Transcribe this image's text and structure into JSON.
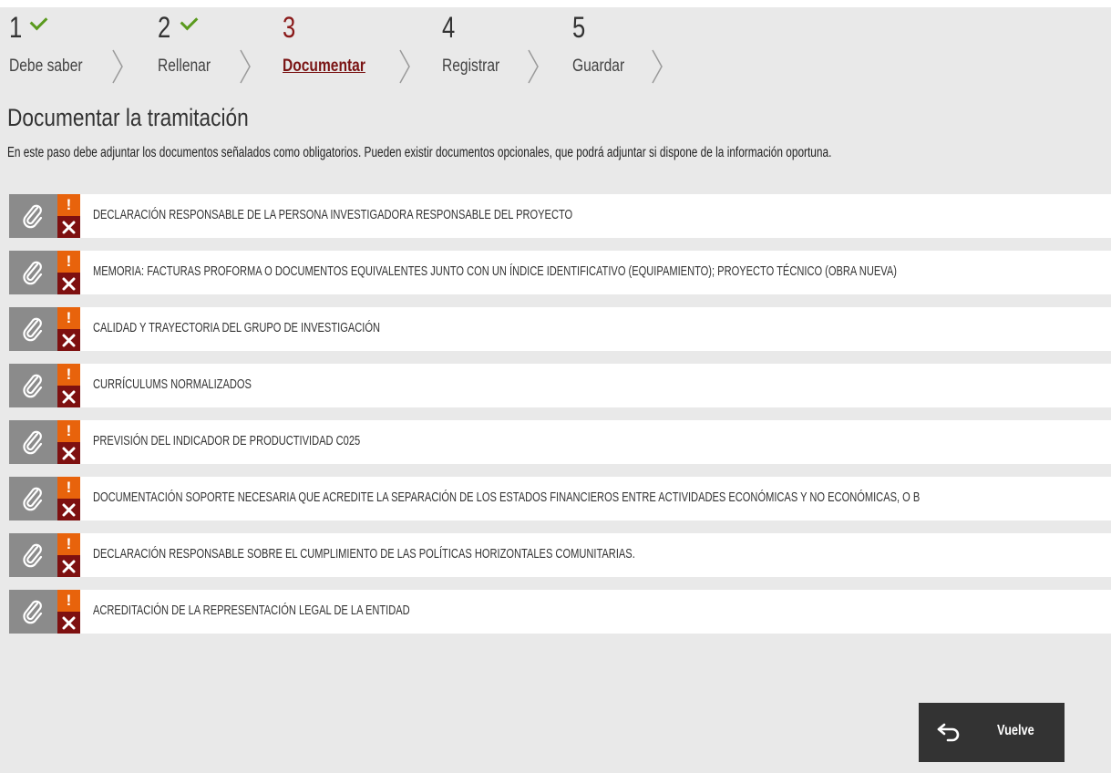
{
  "steps": [
    {
      "number": "1",
      "label": "Debe saber",
      "done": true
    },
    {
      "number": "2",
      "label": "Rellenar",
      "done": true
    },
    {
      "number": "3",
      "label": "Documentar",
      "active": true
    },
    {
      "number": "4",
      "label": "Registrar"
    },
    {
      "number": "5",
      "label": "Guardar"
    }
  ],
  "title": "Documentar la tramitación",
  "intro": "En este paso debe adjuntar los documentos señalados como obligatorios. Pueden existir documentos opcionales, que podrá adjuntar si dispone de la información oportuna.",
  "status_warning_glyph": "!",
  "documents": [
    {
      "name": "DECLARACIÓN RESPONSABLE DE LA PERSONA INVESTIGADORA RESPONSABLE DEL PROYECTO"
    },
    {
      "name": "MEMORIA: FACTURAS PROFORMA O DOCUMENTOS EQUIVALENTES JUNTO CON UN ÍNDICE IDENTIFICATIVO (EQUIPAMIENTO); PROYECTO TÉCNICO (OBRA NUEVA)"
    },
    {
      "name": "CALIDAD Y TRAYECTORIA DEL GRUPO DE INVESTIGACIÓN"
    },
    {
      "name": "CURRÍCULUMS NORMALIZADOS"
    },
    {
      "name": "PREVISIÓN DEL INDICADOR DE PRODUCTIVIDAD C025"
    },
    {
      "name": "DOCUMENTACIÓN SOPORTE NECESARIA QUE ACREDITE LA SEPARACIÓN DE LOS ESTADOS FINANCIEROS ENTRE ACTIVIDADES ECONÓMICAS Y NO ECONÓMICAS, O B"
    },
    {
      "name": "DECLARACIÓN RESPONSABLE SOBRE EL CUMPLIMIENTO DE LAS POLÍTICAS HORIZONTALES COMUNITARIAS."
    },
    {
      "name": "ACREDITACIÓN DE LA REPRESENTACIÓN LEGAL DE LA ENTIDAD"
    }
  ],
  "back_button": {
    "label": "Vuelve"
  },
  "colors": {
    "active_step": "#7a1414",
    "check": "#5a9a1e",
    "warning": "#e8630c",
    "error": "#7e1010",
    "attach": "#8b8b8b",
    "button": "#333333"
  }
}
